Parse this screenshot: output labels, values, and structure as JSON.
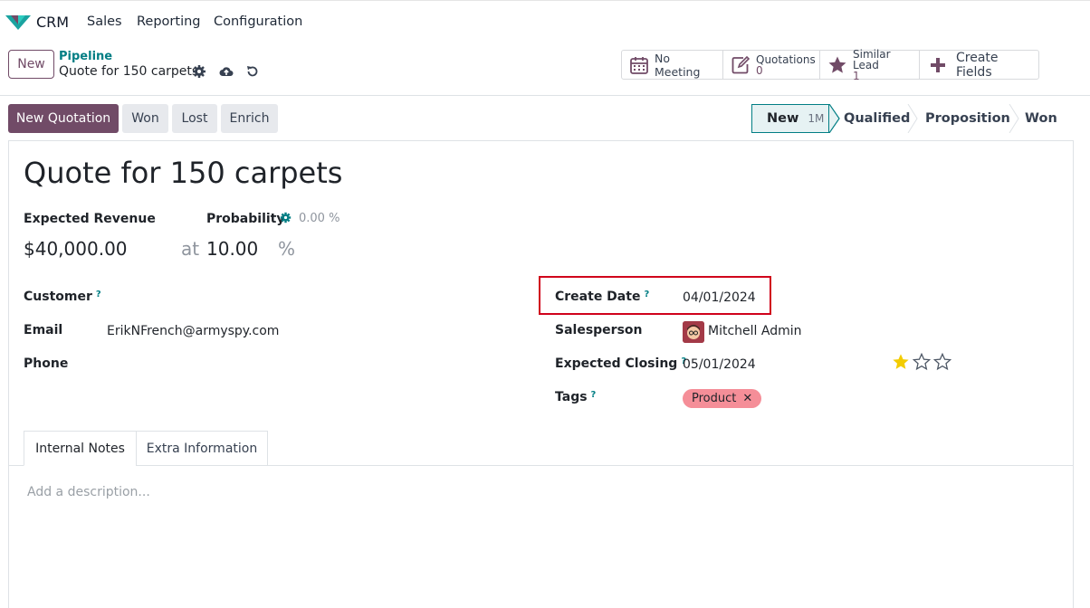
{
  "nav": {
    "app_name": "CRM",
    "menu": [
      "Sales",
      "Reporting",
      "Configuration"
    ]
  },
  "control_panel": {
    "new_label": "New",
    "breadcrumb_parent": "Pipeline",
    "breadcrumb_current": "Quote for 150 carpets",
    "stat_buttons": {
      "meeting": "No Meeting",
      "quotations_label": "Quotations",
      "quotations_count": "0",
      "similar_label": "Similar Lead",
      "similar_count": "1",
      "create_fields": "Create Fields"
    }
  },
  "actions": {
    "new_quotation": "New Quotation",
    "won": "Won",
    "lost": "Lost",
    "enrich": "Enrich"
  },
  "stages": {
    "new": "New",
    "new_badge": "1M",
    "qualified": "Qualified",
    "proposition": "Proposition",
    "won": "Won"
  },
  "form": {
    "title": "Quote for 150 carpets",
    "expected_revenue_label": "Expected Revenue",
    "expected_revenue": "$40,000.00",
    "at": "at",
    "probability_label": "Probability",
    "probability_auto": "0.00 %",
    "probability": "10.00",
    "percent": "%",
    "customer_label": "Customer",
    "email_label": "Email",
    "email": "ErikNFrench@armyspy.com",
    "phone_label": "Phone",
    "create_date_label": "Create Date",
    "create_date": "04/01/2024",
    "salesperson_label": "Salesperson",
    "salesperson": "Mitchell Admin",
    "expected_closing_label": "Expected Closing",
    "expected_closing": "05/01/2024",
    "tags_label": "Tags",
    "tag": "Product",
    "help_mark": "?",
    "priority_stars": 1
  },
  "tabs": {
    "internal_notes": "Internal Notes",
    "extra_information": "Extra Information"
  },
  "notes": {
    "placeholder": "Add a description..."
  },
  "colors": {
    "brand": "#714b67",
    "teal": "#017e84",
    "highlight": "#d0021b",
    "tag": "#f58e98",
    "star": "#f3cc00"
  }
}
